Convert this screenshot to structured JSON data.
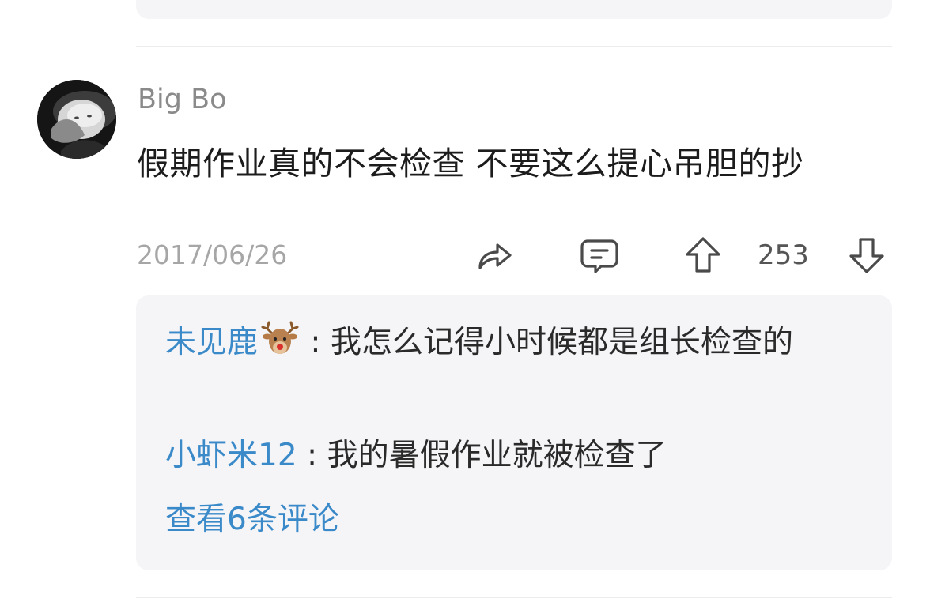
{
  "comment": {
    "username": "Big Bo",
    "text": "假期作业真的不会检查 不要这么提心吊胆的抄",
    "date": "2017/06/26",
    "vote_count": "253"
  },
  "icons": {
    "share": "share-icon",
    "reply": "comment-bubble-icon",
    "upvote": "arrow-up-icon",
    "downvote": "arrow-down-icon",
    "deer_emoji": "deer-emoji"
  },
  "replies": [
    {
      "author": "未见鹿",
      "separator": " : ",
      "text": "我怎么记得小时候都是组长检查的"
    },
    {
      "author": "小虾米12",
      "separator": " : ",
      "text": "我的暑假作业就被检查了"
    }
  ],
  "view_more_label": "查看6条评论",
  "colors": {
    "link_blue": "#3a89c8",
    "reply_box_bg": "#f5f5f8",
    "meta_gray": "#a6a6a6"
  }
}
